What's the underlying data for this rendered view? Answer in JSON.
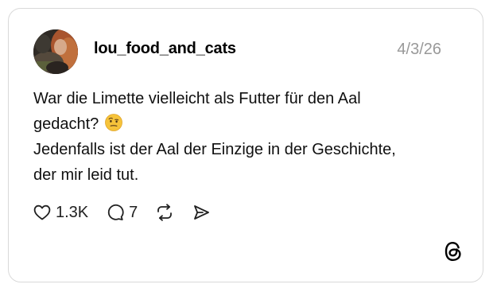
{
  "post": {
    "username": "lou_food_and_cats",
    "date": "4/3/26",
    "text_line_1": "War die Limette vielleicht als Futter für den Aal",
    "text_line_2": "gedacht?",
    "text_emoji": "face-with-raised-eyebrow-emoji",
    "text_line_3": "Jedenfalls ist der Aal der Einzige in der Geschichte,",
    "text_line_4": "der mir leid tut."
  },
  "actions": {
    "like_icon": "heart-icon",
    "like_count": "1.3K",
    "reply_icon": "speech-bubble-icon",
    "reply_count": "7",
    "repost_icon": "repost-icon",
    "share_icon": "send-icon"
  },
  "branding": {
    "logo_icon": "threads-logo-icon"
  },
  "colors": {
    "border": "#d9d9d9",
    "text": "#101010",
    "muted": "#999999",
    "emoji_face": "#f6c33a"
  }
}
